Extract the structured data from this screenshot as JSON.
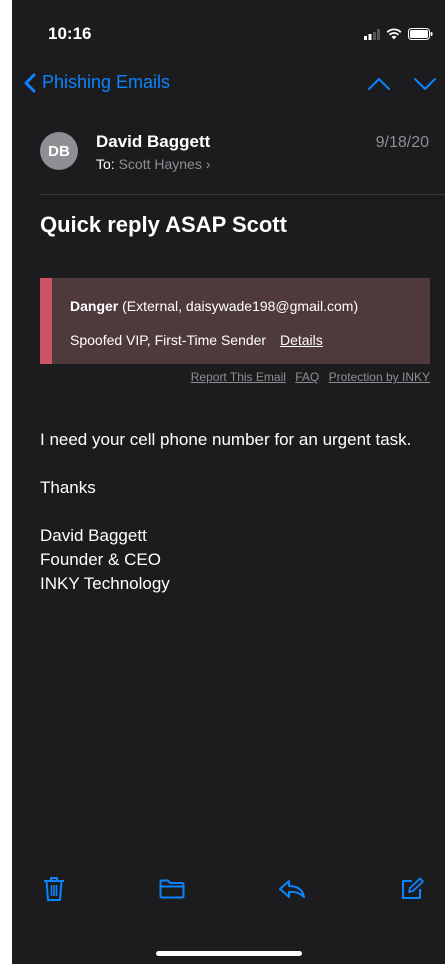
{
  "status": {
    "time": "10:16"
  },
  "nav": {
    "back_label": "Phishing Emails",
    "icons": [
      "chevron-left-icon",
      "chevron-up-icon",
      "chevron-down-icon"
    ]
  },
  "message": {
    "avatar_initials": "DB",
    "sender": "David Baggett",
    "to_label": "To:",
    "to_name": "Scott Haynes",
    "date": "9/18/20",
    "subject": "Quick reply ASAP Scott"
  },
  "banner": {
    "level": "Danger",
    "detail": "(External, daisywade198@gmail.com)",
    "reasons": "Spoofed VIP, First-Time Sender",
    "details_link": "Details",
    "accent_color": "#cc5466"
  },
  "links": {
    "report": "Report This Email",
    "faq": "FAQ",
    "protection": "Protection by INKY"
  },
  "body": {
    "line1": "I need your cell phone number for an urgent task.",
    "thanks": "Thanks",
    "sig_name": "David Baggett",
    "sig_title": "Founder & CEO",
    "sig_company": "INKY Technology"
  },
  "toolbar": {
    "icons": [
      "trash-icon",
      "folder-icon",
      "reply-icon",
      "compose-icon"
    ]
  },
  "colors": {
    "accent": "#0a84ff",
    "background": "#1c1c1e"
  }
}
